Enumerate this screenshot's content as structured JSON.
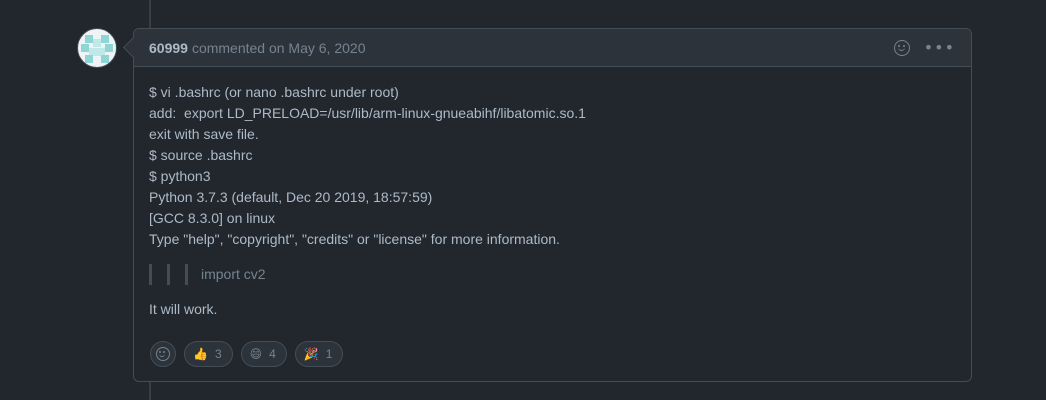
{
  "comment": {
    "author": "60999",
    "meta": "commented on May 6, 2020",
    "body_lines": [
      "$ vi .bashrc (or nano .bashrc under root)",
      "add:  export LD_PRELOAD=/usr/lib/arm-linux-gnueabihf/libatomic.so.1",
      "exit with save file.",
      "$ source .bashrc",
      "$ python3",
      "Python 3.7.3 (default, Dec 20 2019, 18:57:59)",
      "[GCC 8.3.0] on linux",
      "Type \"help\", \"copyright\", \"credits\" or \"license\" for more information."
    ],
    "quote_text": "import cv2",
    "closing_text": "It will work."
  },
  "header_icons": {
    "reaction": "smiley-icon",
    "more": "kebab-icon"
  },
  "reactions": [
    {
      "emoji": "👍",
      "name": "thumbs-up",
      "count": "3"
    },
    {
      "emoji": "😄",
      "name": "laugh",
      "count": "4"
    },
    {
      "emoji": "🎉",
      "name": "hooray",
      "count": "1"
    }
  ],
  "colors": {
    "background": "#22272e",
    "header": "#2d333b",
    "border": "#444c56",
    "text": "#adbac7",
    "muted": "#768390"
  }
}
